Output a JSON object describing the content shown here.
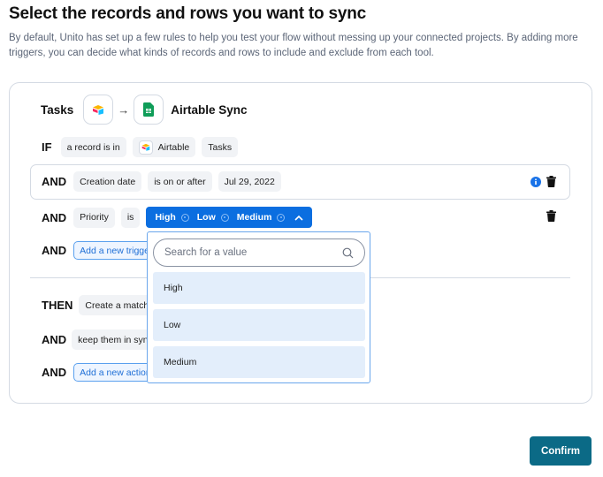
{
  "page": {
    "title": "Select the records and rows you want to sync",
    "description": "By default, Unito has set up a few rules to help you test your flow without messing up your connected projects. By adding more triggers, you can decide what kinds of records and rows to include and exclude from each tool."
  },
  "header": {
    "source_label": "Tasks",
    "source_icon": "airtable-icon",
    "arrow": "→",
    "target_icon": "google-sheets-icon",
    "target_label": "Airtable Sync"
  },
  "rules": {
    "if": {
      "keyword": "IF",
      "condition": "a record is in",
      "tool": "Airtable",
      "table": "Tasks"
    },
    "and_date": {
      "keyword": "AND",
      "field": "Creation date",
      "operator": "is on or after",
      "value": "Jul 29, 2022"
    },
    "and_priority": {
      "keyword": "AND",
      "field": "Priority",
      "operator": "is",
      "selected": [
        "High",
        "Low",
        "Medium"
      ]
    },
    "and_add": {
      "keyword": "AND",
      "label": "Add a new trigger"
    },
    "then": {
      "keyword": "THEN",
      "action": "Create a matching row"
    },
    "and_keep": {
      "keyword": "AND",
      "action": "keep them in sync"
    },
    "and_action": {
      "keyword": "AND",
      "label": "Add a new action"
    }
  },
  "dropdown": {
    "search_placeholder": "Search for a value",
    "options": [
      "High",
      "Low",
      "Medium"
    ]
  },
  "footer": {
    "confirm_label": "Confirm"
  },
  "colors": {
    "accent": "#0b6ee0",
    "confirm": "#0b6a86"
  }
}
